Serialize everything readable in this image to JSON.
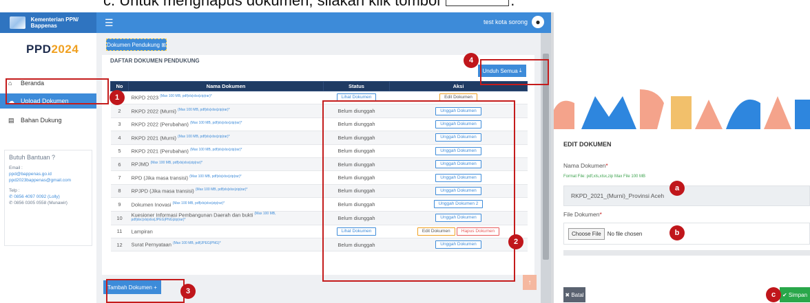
{
  "caption": {
    "text": "Untuk menghapus dokumen, silakan klik tombol",
    "end": "."
  },
  "topbar": {
    "brand": "Kementerian PPN/ Bappenas",
    "user": "test kota sorong"
  },
  "sidebar": {
    "logo_a": "PPD",
    "logo_b": "2024",
    "items": [
      {
        "label": "Beranda",
        "icon": "home-icon"
      },
      {
        "label": "Upload Dokumen",
        "icon": "cloud-upload-icon"
      },
      {
        "label": "Bahan Dukung",
        "icon": "document-icon"
      }
    ],
    "help": {
      "title": "Butuh Bantuan ?",
      "email_label": "Email :",
      "email1": "ppd@bappenas.go.id",
      "email2": "ppd2023bappenas@gmail.com",
      "tel_label": "Telp :",
      "tel1": "✆ 0856 4097 0092 (Lolly)",
      "tel2": "✆ 0856 0305 0558 (Munawir)"
    }
  },
  "content": {
    "tab": "Dokumen Pendukung ⊞",
    "card_title": "DAFTAR DOKUMEN PENDUKUNG",
    "unduh": "Unduh Semua",
    "headers": [
      "No",
      "Nama Dokumen",
      "Status",
      "Aksi"
    ],
    "rows": [
      {
        "no": "1",
        "name": "RKPD 2023",
        "note": "(Max 100 MB, pdf|xls|xlsx|zip|rar)*",
        "status": "Lihat Dokumen",
        "status_btn": true,
        "aksi": [
          "Edit Dokumen"
        ]
      },
      {
        "no": "2",
        "name": "RKPD 2022 (Murni)",
        "note": "(Max 100 MB, pdf|xls|xlsx|zip|rar)*",
        "status": "Belum diunggah",
        "aksi": [
          "Unggah Dokumen"
        ]
      },
      {
        "no": "3",
        "name": "RKPD 2022 (Perubahan)",
        "note": "(Max 100 MB, pdf|xls|xlsx|zip|rar)*",
        "status": "Belum diunggah",
        "aksi": [
          "Unggah Dokumen"
        ]
      },
      {
        "no": "4",
        "name": "RKPD 2021 (Murni)",
        "note": "(Max 100 MB, pdf|xls|xlsx|zip|rar)*",
        "status": "Belum diunggah",
        "aksi": [
          "Unggah Dokumen"
        ]
      },
      {
        "no": "5",
        "name": "RKPD 2021 (Perubahan)",
        "note": "(Max 100 MB, pdf|xls|xlsx|zip|rar)*",
        "status": "Belum diunggah",
        "aksi": [
          "Unggah Dokumen"
        ]
      },
      {
        "no": "6",
        "name": "RPJMD",
        "note": "(Max 100 MB, pdf|xls|xlsx|zip|rar)*",
        "status": "Belum diunggah",
        "aksi": [
          "Unggah Dokumen"
        ]
      },
      {
        "no": "7",
        "name": "RPD (Jika masa transisi)",
        "note": "(Max 100 MB, pdf|xls|xlsx|zip|rar)*",
        "status": "Belum diunggah",
        "aksi": [
          "Unggah Dokumen"
        ]
      },
      {
        "no": "8",
        "name": "RPJPD (Jika masa transisi)",
        "note": "(Max 100 MB, pdf|xls|xlsx|zip|rar)*",
        "status": "Belum diunggah",
        "aksi": [
          "Unggah Dokumen"
        ]
      },
      {
        "no": "9",
        "name": "Dokumen Inovasi",
        "note": "(Max 100 MB, pdf|xls|xlsx|zip|rar)*",
        "status": "Belum diunggah",
        "aksi": [
          "Unggah Dokumen 2"
        ]
      },
      {
        "no": "10",
        "name": "Kuesioner Informasi Pembangunan Daerah dan bukti",
        "note": "(Max 100 MB, pdf|doc|xls|xlsx|JPEG|PNG|zip|rar)*",
        "status": "Belum diunggah",
        "aksi": [
          "Unggah Dokumen"
        ]
      },
      {
        "no": "11",
        "name": "Lampiran",
        "note": "",
        "status": "Lihat Dokumen",
        "status_btn": true,
        "aksi": [
          "Edit Dokumen",
          "Hapus Dokumen"
        ]
      },
      {
        "no": "12",
        "name": "Surat Pernyataan",
        "note": "(Max 100 MB, pdf|JPEG|PNG)*",
        "status": "Belum diunggah",
        "aksi": [
          "Unggah Dokumen"
        ]
      }
    ],
    "tambah": "Tambah Dokumen"
  },
  "markers": [
    "1",
    "2",
    "3",
    "4",
    "a",
    "b",
    "c"
  ],
  "panel": {
    "title": "EDIT DOKUMEN",
    "nama_label": "Nama Dokumen",
    "hint": "Format File: pdf,xls,xlsx,zip Max File 100 MB",
    "nama_value": "RKPD_2021_(Murni)_Provinsi Aceh",
    "file_label": "File Dokumen",
    "choose": "Choose File",
    "no_file": "No file chosen",
    "batal": "✖ Batal",
    "simpan": "✔ Simpan"
  },
  "colors": {
    "primary": "#3d8bd9",
    "header": "#1f3b63",
    "highlight": "#c41b1b",
    "save": "#29a74a"
  }
}
